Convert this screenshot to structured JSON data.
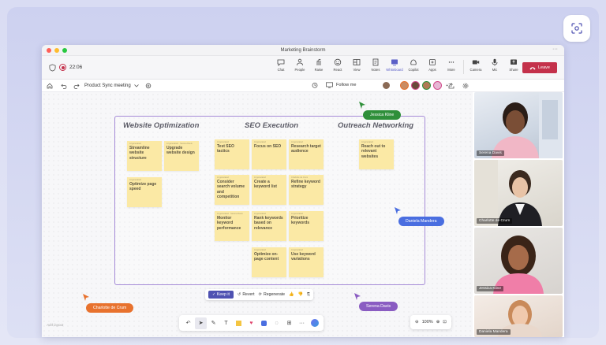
{
  "window": {
    "title": "Marketing Brainstorm"
  },
  "call": {
    "timer": "22:06"
  },
  "toolbar": {
    "items": [
      {
        "label": "Chat",
        "icon": "chat-icon"
      },
      {
        "label": "People",
        "icon": "people-icon"
      },
      {
        "label": "Raise",
        "icon": "raise-hand-icon"
      },
      {
        "label": "React",
        "icon": "react-icon"
      },
      {
        "label": "View",
        "icon": "view-icon"
      },
      {
        "label": "Notes",
        "icon": "notes-icon"
      },
      {
        "label": "Whiteboard",
        "icon": "whiteboard-icon",
        "active": true
      },
      {
        "label": "Copilot",
        "icon": "copilot-icon"
      },
      {
        "label": "Apps",
        "icon": "apps-icon"
      },
      {
        "label": "More",
        "icon": "more-icon"
      },
      {
        "label": "Camera",
        "icon": "camera-icon"
      },
      {
        "label": "Mic",
        "icon": "mic-icon"
      },
      {
        "label": "Share",
        "icon": "share-icon"
      }
    ],
    "leave_label": "Leave"
  },
  "subbar": {
    "meeting_name": "Product Sync meeting",
    "follow_label": "Follow me",
    "avatar_extra_count": "+2"
  },
  "board": {
    "columns": [
      "Website Optimization",
      "SEO Execution",
      "Outreach Networking"
    ],
    "notes": [
      {
        "text": "Streamline website structure",
        "meta": "AI generated"
      },
      {
        "text": "Upgrade website design",
        "meta": "AI generated · Serena Davis"
      },
      {
        "text": "Optimize page speed",
        "meta": "AI generated"
      },
      {
        "text": "Test SEO tactics",
        "meta": "AI generated"
      },
      {
        "text": "Focus on SEO",
        "meta": "AI generated"
      },
      {
        "text": "Research target audience",
        "meta": "AI generated"
      },
      {
        "text": "Consider search volume and competition",
        "meta": "AI generated"
      },
      {
        "text": "Create a keyword list",
        "meta": "AI generated"
      },
      {
        "text": "Refine keyword strategy",
        "meta": "Charlotte de Crum"
      },
      {
        "text": "Monitor keyword performance",
        "meta": "AI generated · Serena Davis"
      },
      {
        "text": "Rank keywords based on relevance",
        "meta": "AI generated"
      },
      {
        "text": "Prioritize keywords",
        "meta": "AI generated"
      },
      {
        "text": "Optimize on-page content",
        "meta": "AI generated"
      },
      {
        "text": "Use keyword variations",
        "meta": "AI generated"
      },
      {
        "text": "Reach out to relevant websites",
        "meta": "AI generated"
      }
    ]
  },
  "cursors": [
    {
      "name": "Jessica Kline",
      "color": "#2f8f3a"
    },
    {
      "name": "Daniela Mandera",
      "color": "#4a6ee0"
    },
    {
      "name": "Charlotte de Crum",
      "color": "#e8722e"
    },
    {
      "name": "Serena Davis",
      "color": "#8a5cc2"
    }
  ],
  "ai_actions": {
    "keep": "Keep it",
    "revert": "Revert",
    "regenerate": "Regenerate"
  },
  "zoom": {
    "level": "100%"
  },
  "powered_by": "Add layout",
  "participants": [
    {
      "name": "Serena Davis"
    },
    {
      "name": "Charlotte de Crum"
    },
    {
      "name": "Jessica Kline"
    },
    {
      "name": "Daniela Mandera"
    }
  ],
  "colors": {
    "accent": "#5b5fc7",
    "leave": "#c4314b",
    "sticky": "#fbe9a5",
    "board_border": "#a58bd7"
  }
}
